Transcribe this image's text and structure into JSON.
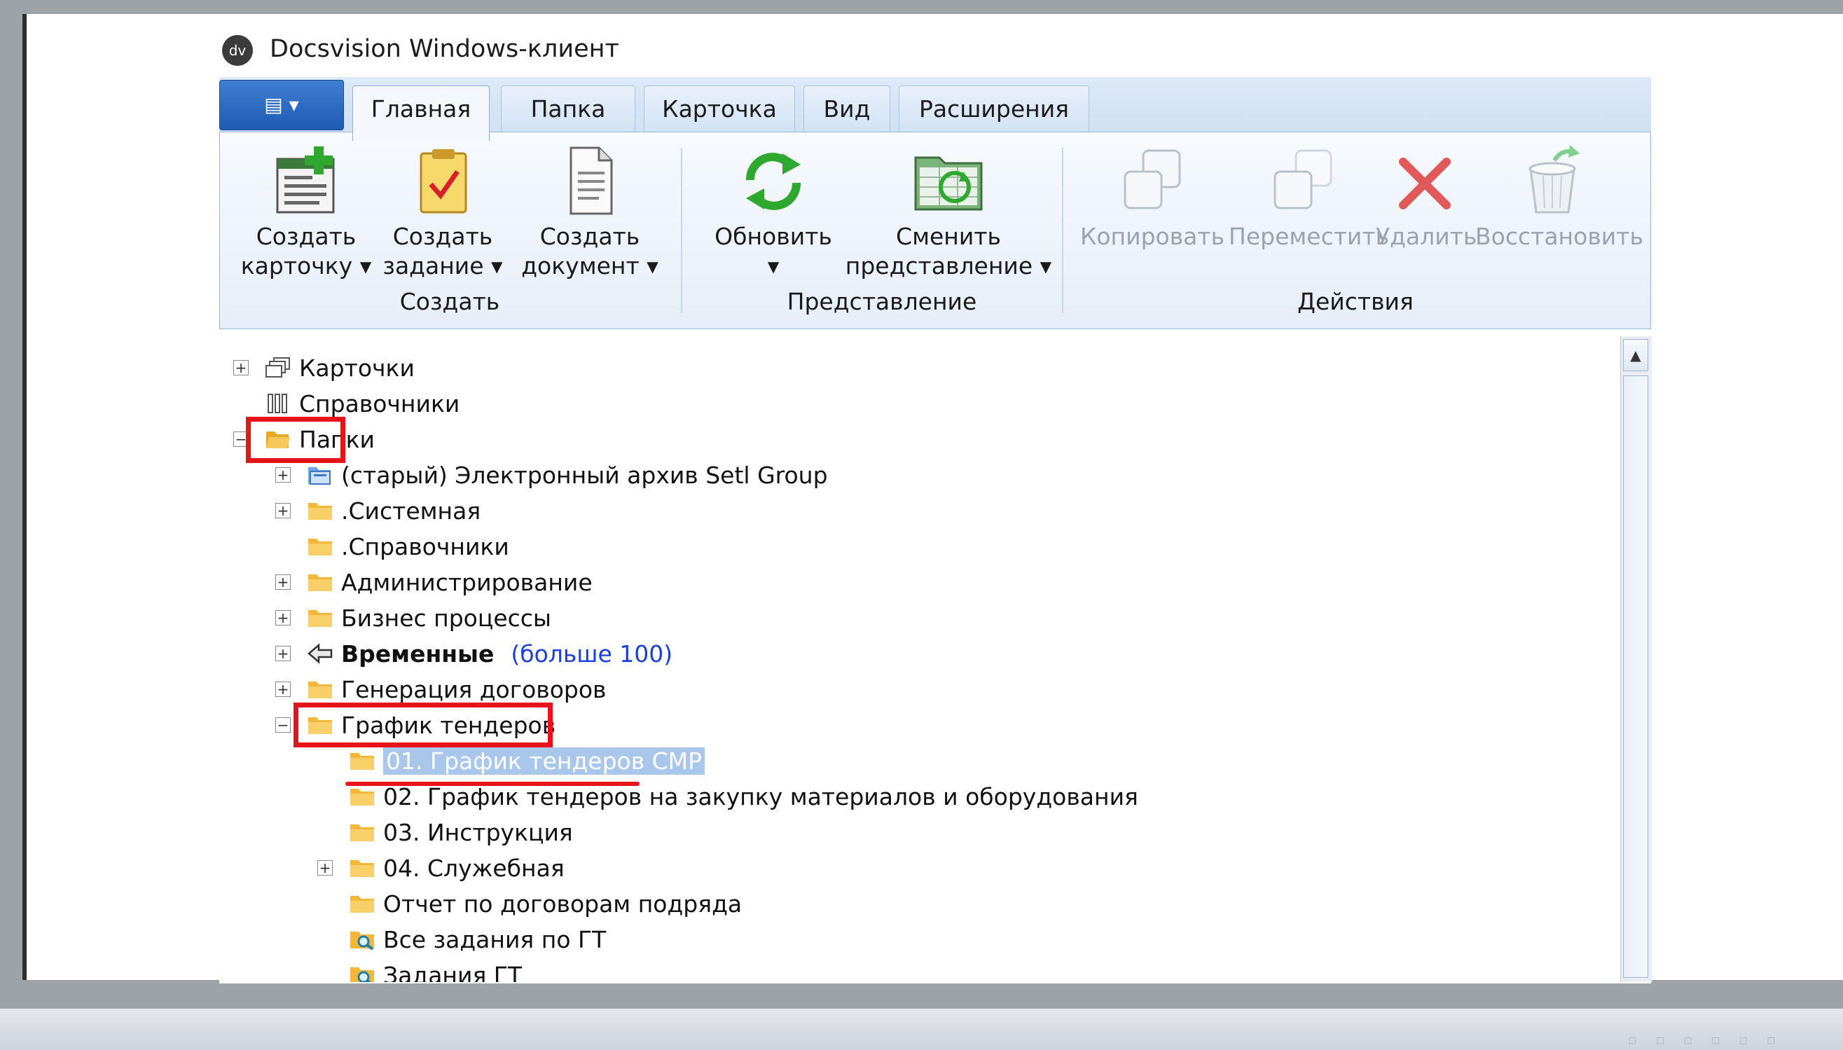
{
  "window": {
    "logo_text": "dv",
    "title": "Docsvision Windows-клиент"
  },
  "app_menu": {
    "label": "▤ ▾"
  },
  "tabs": [
    {
      "label": "Главная",
      "active": true
    },
    {
      "label": "Папка"
    },
    {
      "label": "Карточка"
    },
    {
      "label": "Вид"
    },
    {
      "label": "Расширения"
    }
  ],
  "ribbon": {
    "groups": [
      {
        "label": "Создать"
      },
      {
        "label": "Представление"
      },
      {
        "label": "Действия"
      }
    ],
    "buttons": [
      {
        "icon": "create-card-icon",
        "line1": "Создать",
        "line2": "карточку ▾"
      },
      {
        "icon": "create-task-icon",
        "line1": "Создать",
        "line2": "задание ▾"
      },
      {
        "icon": "create-document-icon",
        "line1": "Создать",
        "line2": "документ ▾"
      },
      {
        "icon": "refresh-icon",
        "line1": "Обновить",
        "line2": "▾"
      },
      {
        "icon": "change-view-icon",
        "line1": "Сменить",
        "line2": "представление ▾"
      },
      {
        "icon": "copy-icon",
        "line1": "Копировать",
        "disabled": true
      },
      {
        "icon": "move-icon",
        "line1": "Переместить",
        "disabled": true
      },
      {
        "icon": "delete-icon",
        "line1": "Удалить",
        "disabled": true
      },
      {
        "icon": "restore-icon",
        "line1": "Восстановить",
        "disabled": true
      }
    ]
  },
  "tree": {
    "items": [
      {
        "label": "Карточки",
        "icon": "cards-icon",
        "expander": "+"
      },
      {
        "label": "Справочники",
        "icon": "dictionaries-icon"
      },
      {
        "label": "Папки",
        "icon": "folder-open-icon",
        "expander": "−"
      },
      {
        "label": "(старый) Электронный архив Setl Group",
        "icon": "archive-icon",
        "expander": "+"
      },
      {
        "label": ".Системная",
        "icon": "folder-icon",
        "expander": "+"
      },
      {
        "label": ".Справочники",
        "icon": "folder-icon"
      },
      {
        "label": "Администрирование",
        "icon": "folder-icon",
        "expander": "+"
      },
      {
        "label": "Бизнес процессы",
        "icon": "folder-icon",
        "expander": "+"
      },
      {
        "label": "Временные",
        "icon": "temp-folder-icon",
        "expander": "+",
        "extra": "(больше 100)"
      },
      {
        "label": "Генерация договоров",
        "icon": "folder-icon",
        "expander": "+"
      },
      {
        "label": "График тендеров",
        "icon": "folder-icon",
        "expander": "−"
      },
      {
        "label": "01. График тендеров СМР",
        "icon": "folder-icon",
        "selected": true
      },
      {
        "label": "02. График тендеров на закупку материалов и оборудования",
        "icon": "folder-icon"
      },
      {
        "label": "03. Инструкция",
        "icon": "folder-icon"
      },
      {
        "label": "04. Служебная",
        "icon": "folder-icon",
        "expander": "+"
      },
      {
        "label": "Отчет по договорам подряда",
        "icon": "folder-icon"
      },
      {
        "label": "Все задания по ГТ",
        "icon": "search-folder-icon"
      },
      {
        "label": "Задания ГТ",
        "icon": "search-folder-icon"
      }
    ]
  },
  "colors": {
    "highlight": "#e8141b",
    "ribbon_blue": "#c9dcf2",
    "selection": "#a9c7ea"
  }
}
